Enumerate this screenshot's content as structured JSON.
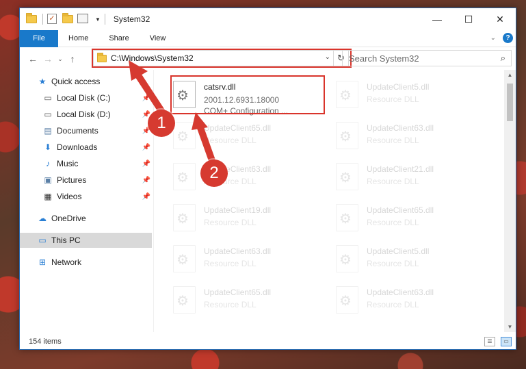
{
  "window": {
    "title": "System32",
    "controls": {
      "minimize": "—",
      "maximize": "☐",
      "close": "✕"
    }
  },
  "ribbon": {
    "tabs": [
      "File",
      "Home",
      "Share",
      "View"
    ],
    "help": "?"
  },
  "nav": {
    "back": "←",
    "forward": "→",
    "recent": "⌄",
    "up": "↑",
    "address": "C:\\Windows\\System32",
    "refresh": "↻",
    "search_placeholder": "Search System32",
    "search_icon": "⌕"
  },
  "sidebar": {
    "items": [
      {
        "label": "Quick access",
        "icon": "star-icon",
        "glyph": "★"
      },
      {
        "label": "Local Disk (C:)",
        "icon": "drive-icon",
        "glyph": "▭"
      },
      {
        "label": "Local Disk (D:)",
        "icon": "drive-icon",
        "glyph": "▭"
      },
      {
        "label": "Documents",
        "icon": "documents-icon",
        "glyph": "▤"
      },
      {
        "label": "Downloads",
        "icon": "downloads-icon",
        "glyph": "⬇"
      },
      {
        "label": "Music",
        "icon": "music-icon",
        "glyph": "♪"
      },
      {
        "label": "Pictures",
        "icon": "pictures-icon",
        "glyph": "▣"
      },
      {
        "label": "Videos",
        "icon": "videos-icon",
        "glyph": "▦"
      },
      {
        "label": "OneDrive",
        "icon": "cloud-icon",
        "glyph": "☁"
      },
      {
        "label": "This PC",
        "icon": "computer-icon",
        "glyph": "▭"
      },
      {
        "label": "Network",
        "icon": "network-icon",
        "glyph": "⊞"
      }
    ],
    "pin_glyph": "📌"
  },
  "files": [
    {
      "name": "catsrv.dll",
      "line2": "2001.12.6931.18000",
      "line3": "COM+ Configuration ...",
      "faded": false
    },
    {
      "name": "UpdateClient5.dll",
      "line2": "Resource DLL",
      "faded": true
    },
    {
      "name": "UpdateClient65.dll",
      "line2": "Resource DLL",
      "faded": true
    },
    {
      "name": "UpdateClient63.dll",
      "line2": "Resource DLL",
      "faded": true
    },
    {
      "name": "UpdateClient63.dll",
      "line2": "Resource DLL",
      "faded": true
    },
    {
      "name": "UpdateClient21.dll",
      "line2": "Resource DLL",
      "faded": true
    },
    {
      "name": "UpdateClient19.dll",
      "line2": "Resource DLL",
      "faded": true
    },
    {
      "name": "UpdateClient65.dll",
      "line2": "Resource DLL",
      "faded": true
    },
    {
      "name": "UpdateClient63.dll",
      "line2": "Resource DLL",
      "faded": true
    },
    {
      "name": "UpdateClient5.dll",
      "line2": "Resource DLL",
      "faded": true
    },
    {
      "name": "UpdateClient65.dll",
      "line2": "Resource DLL",
      "faded": true
    },
    {
      "name": "UpdateClient63.dll",
      "line2": "Resource DLL",
      "faded": true
    }
  ],
  "status": {
    "item_count": "154 items"
  },
  "annotations": {
    "step1": "1",
    "step2": "2",
    "color": "#d63a30"
  },
  "colors": {
    "accent": "#1979ca",
    "highlight": "#d9342b"
  }
}
